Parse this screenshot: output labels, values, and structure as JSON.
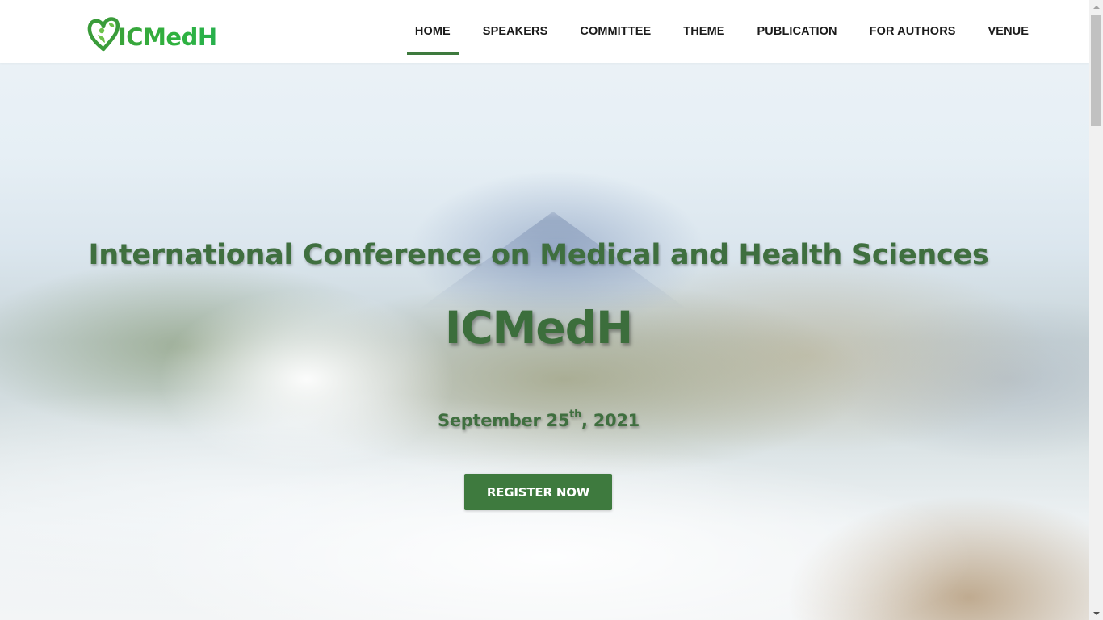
{
  "header": {
    "logo_text": "ICMedH",
    "nav": [
      {
        "label": "HOME",
        "active": true
      },
      {
        "label": "SPEAKERS"
      },
      {
        "label": "COMMITTEE"
      },
      {
        "label": "THEME"
      },
      {
        "label": "PUBLICATION"
      },
      {
        "label": "FOR AUTHORS"
      },
      {
        "label": "VENUE"
      }
    ]
  },
  "hero": {
    "subtitle": "International Conference on Medical and Health Sciences",
    "title": "ICMedH",
    "date_prefix": "September 25",
    "date_sup": "th",
    "date_suffix": ", 2021",
    "register_label": "REGISTER NOW"
  },
  "colors": {
    "brand_green": "#3e7a3e",
    "logo_green": "#2fb23f",
    "heading_green": "#3f6f3f"
  },
  "icons": {
    "logo": "heart-leaf-person-icon",
    "scroll_up": "scroll-up-arrow-icon",
    "scroll_down": "scroll-down-arrow-icon"
  }
}
